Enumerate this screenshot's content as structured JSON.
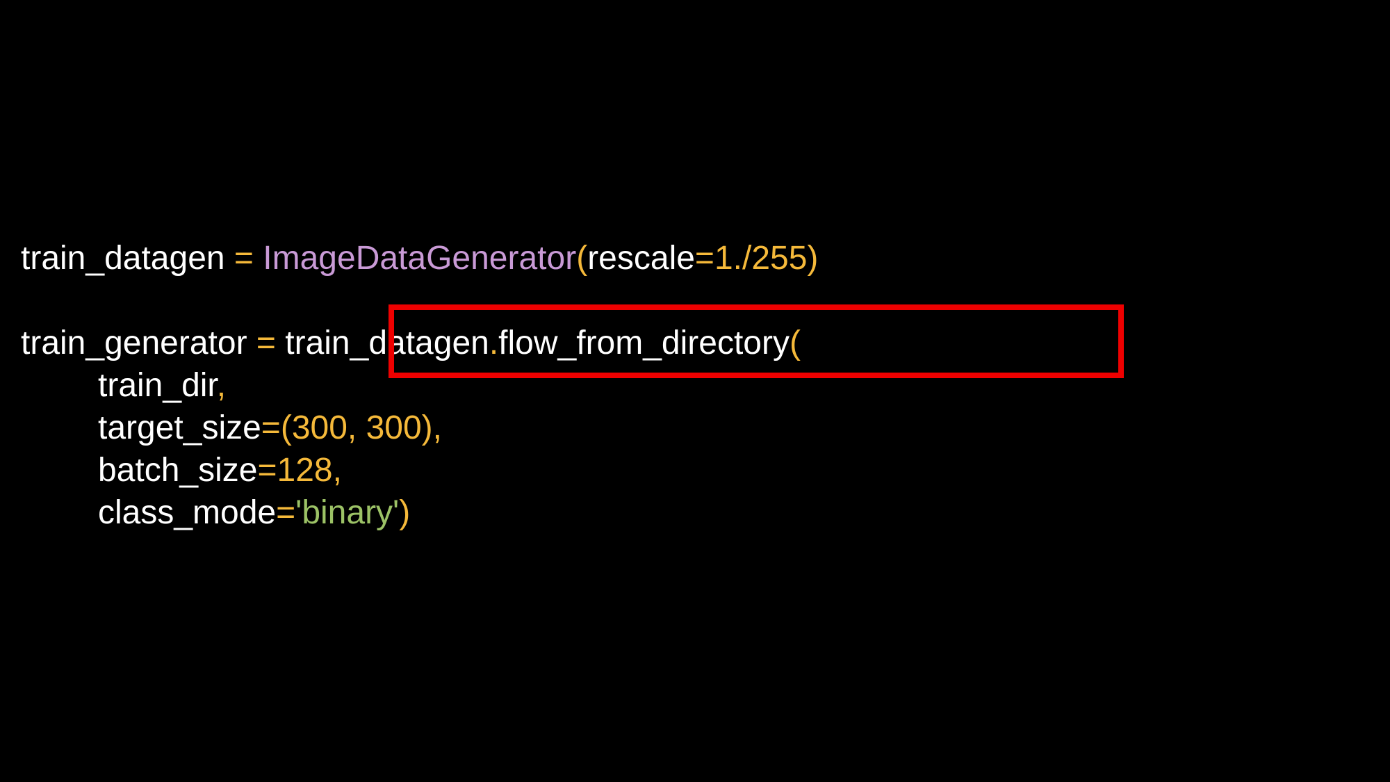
{
  "colors": {
    "background": "#000000",
    "identifier": "#ffffff",
    "operator": "#f5b93a",
    "class_name": "#c99ad6",
    "number": "#f5b93a",
    "string": "#9cc266",
    "highlight_border": "#ee0000"
  },
  "code": {
    "line1": {
      "var": "train_datagen",
      "assign": " = ",
      "cls": "ImageDataGenerator",
      "open": "(",
      "kw": "rescale",
      "eq": "=",
      "val": "1./255",
      "close": ")"
    },
    "line2": {
      "var": "train_generator",
      "assign": " = ",
      "obj": "train_datagen",
      "dot": ".",
      "method": "flow_from_directory",
      "open": "("
    },
    "line3": {
      "arg": "train_dir",
      "comma": ","
    },
    "line4": {
      "kw": "target_size",
      "eq": "=",
      "val": "(300, 300),"
    },
    "line5": {
      "kw": "batch_size",
      "eq": "=",
      "val": "128,"
    },
    "line6": {
      "kw": "class_mode",
      "eq": "=",
      "str": "'binary'",
      "close": ")"
    }
  }
}
